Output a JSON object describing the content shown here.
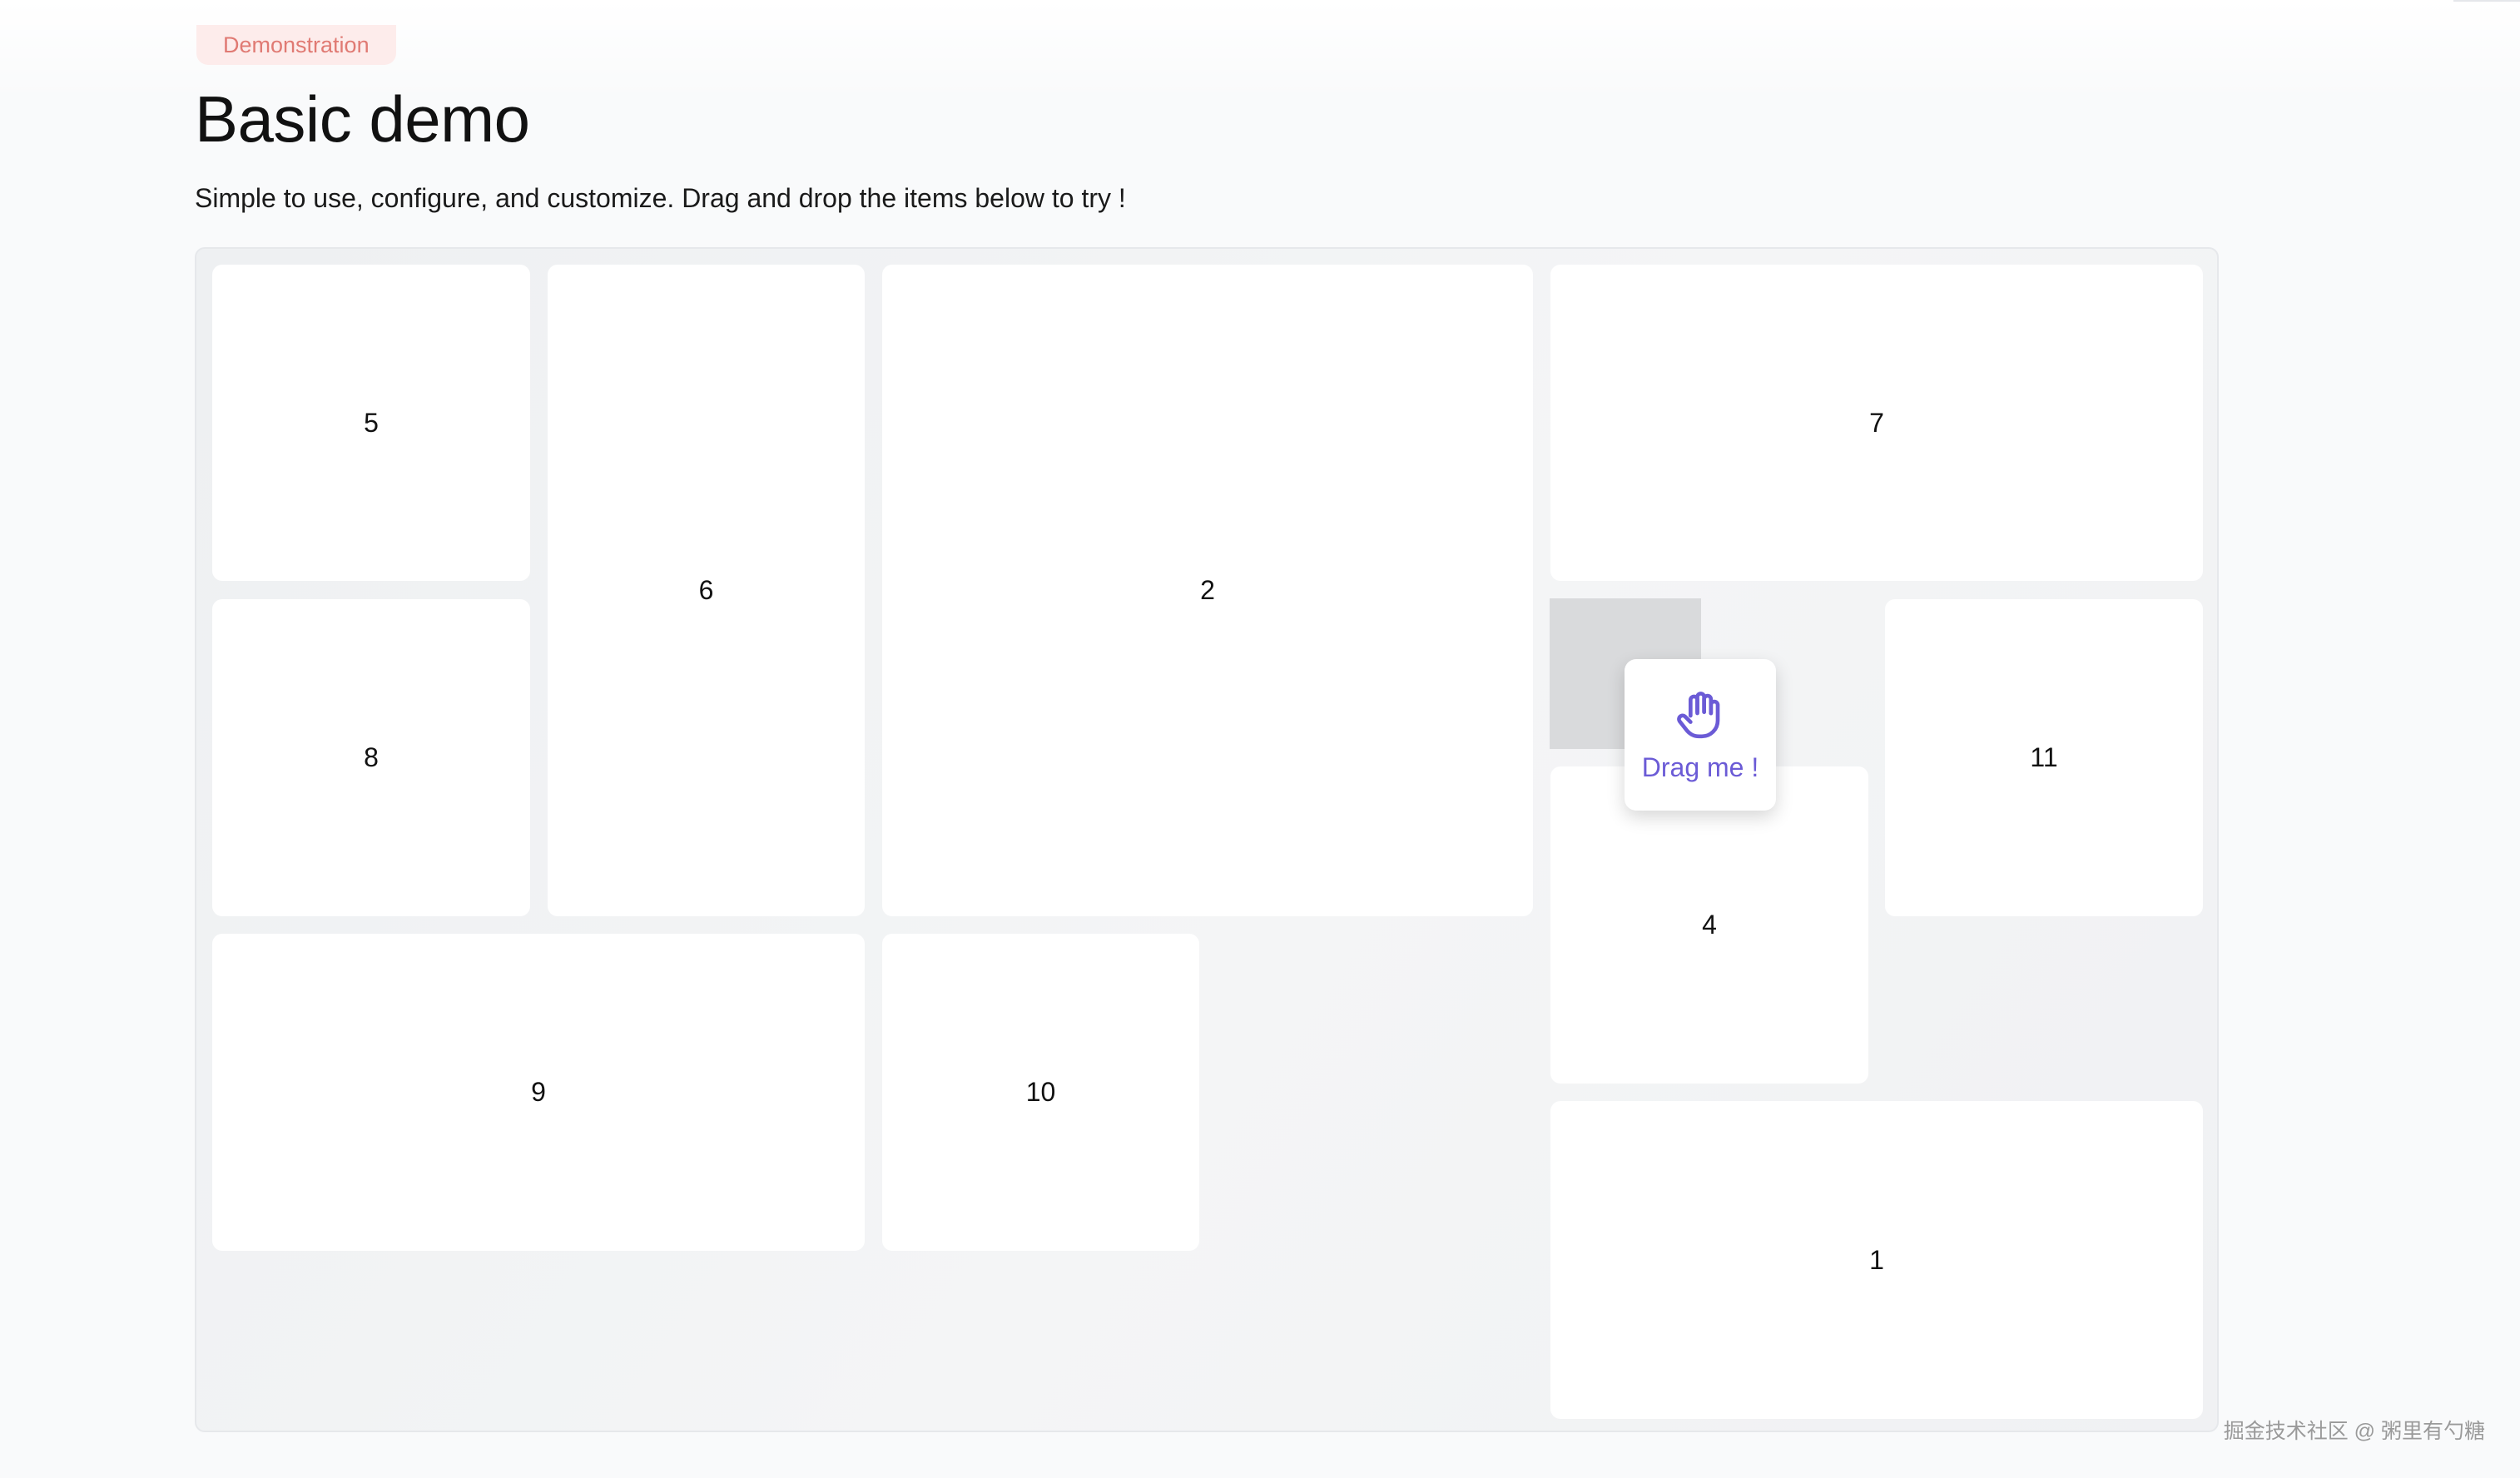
{
  "header": {
    "badge": "Demonstration",
    "title": "Basic demo",
    "subtitle": "Simple to use, configure, and customize. Drag and drop the items below to try !"
  },
  "grid": {
    "items": [
      "5",
      "6",
      "2",
      "7",
      "8",
      "11",
      "4",
      "9",
      "10",
      "1"
    ],
    "drag_card_label": "Drag me !",
    "drag_icon": "hand-icon"
  },
  "watermark": "掘金技术社区 @ 粥里有勺糖",
  "colors": {
    "badge_bg": "#fdeceb",
    "badge_text": "#e07a73",
    "accent": "#6b5bd6",
    "board_bg": "#eef0f2",
    "placeholder": "#d9dadc"
  }
}
